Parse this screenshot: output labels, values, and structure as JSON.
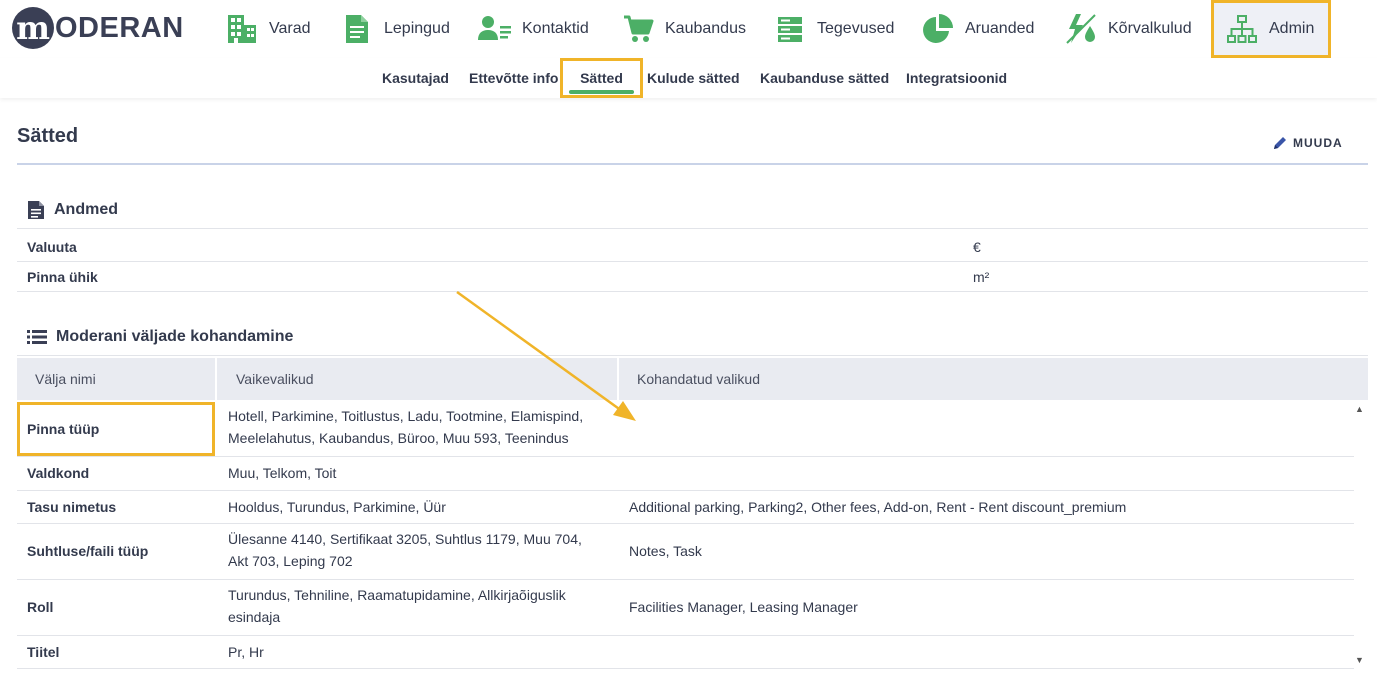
{
  "brand": {
    "logo_letter": "m",
    "logo_text": "ODERAN"
  },
  "nav": {
    "items": [
      {
        "id": "varad",
        "label": "Varad",
        "icon": "building-icon"
      },
      {
        "id": "lepingud",
        "label": "Lepingud",
        "icon": "document-icon"
      },
      {
        "id": "kontaktid",
        "label": "Kontaktid",
        "icon": "contacts-icon"
      },
      {
        "id": "kaubandus",
        "label": "Kaubandus",
        "icon": "cart-icon"
      },
      {
        "id": "tegevused",
        "label": "Tegevused",
        "icon": "server-icon"
      },
      {
        "id": "aruanded",
        "label": "Aruanded",
        "icon": "pie-chart-icon"
      },
      {
        "id": "korvalkulud",
        "label": "Kõrvalkulud",
        "icon": "utilities-icon"
      },
      {
        "id": "admin",
        "label": "Admin",
        "icon": "sitemap-icon"
      }
    ],
    "active": "admin"
  },
  "subnav": {
    "items": [
      {
        "id": "kasutajad",
        "label": "Kasutajad"
      },
      {
        "id": "ettevotte-info",
        "label": "Ettevõtte info"
      },
      {
        "id": "satted",
        "label": "Sätted"
      },
      {
        "id": "kulude-satted",
        "label": "Kulude sätted"
      },
      {
        "id": "kaubanduse-satted",
        "label": "Kaubanduse sätted"
      },
      {
        "id": "integratsioonid",
        "label": "Integratsioonid"
      }
    ],
    "active": "satted"
  },
  "page": {
    "title": "Sätted",
    "edit_label": "MUUDA"
  },
  "andmed": {
    "heading": "Andmed",
    "rows": [
      {
        "label": "Valuuta",
        "value": "€"
      },
      {
        "label": "Pinna ühik",
        "value": "m²"
      }
    ]
  },
  "fields": {
    "heading": "Moderani väljade kohandamine",
    "columns": [
      "Välja nimi",
      "Vaikevalikud",
      "Kohandatud valikud"
    ],
    "rows": [
      {
        "name": "Pinna tüüp",
        "defaults": "Hotell, Parkimine, Toitlustus, Ladu, Tootmine, Elamispind, Meelelahutus, Kaubandus, Büroo, Muu 593, Teenindus",
        "custom": ""
      },
      {
        "name": "Valdkond",
        "defaults": "Muu, Telkom, Toit",
        "custom": ""
      },
      {
        "name": "Tasu nimetus",
        "defaults": "Hooldus, Turundus, Parkimine, Üür",
        "custom": "Additional parking, Parking2, Other fees, Add-on, Rent - Rent discount_premium"
      },
      {
        "name": "Suhtluse/faili tüüp",
        "defaults": "Ülesanne 4140, Sertifikaat 3205, Suhtlus 1179, Muu 704, Akt 703, Leping 702",
        "custom": "Notes, Task"
      },
      {
        "name": "Roll",
        "defaults": "Turundus, Tehniline, Raamatupidamine, Allkirjaõiguslik esindaja",
        "custom": "Facilities Manager, Leasing Manager"
      },
      {
        "name": "Tiitel",
        "defaults": "Pr, Hr",
        "custom": ""
      }
    ]
  },
  "colors": {
    "accent_green": "#4caf66",
    "highlight_orange": "#f0b429",
    "text_dark": "#333a4d"
  }
}
